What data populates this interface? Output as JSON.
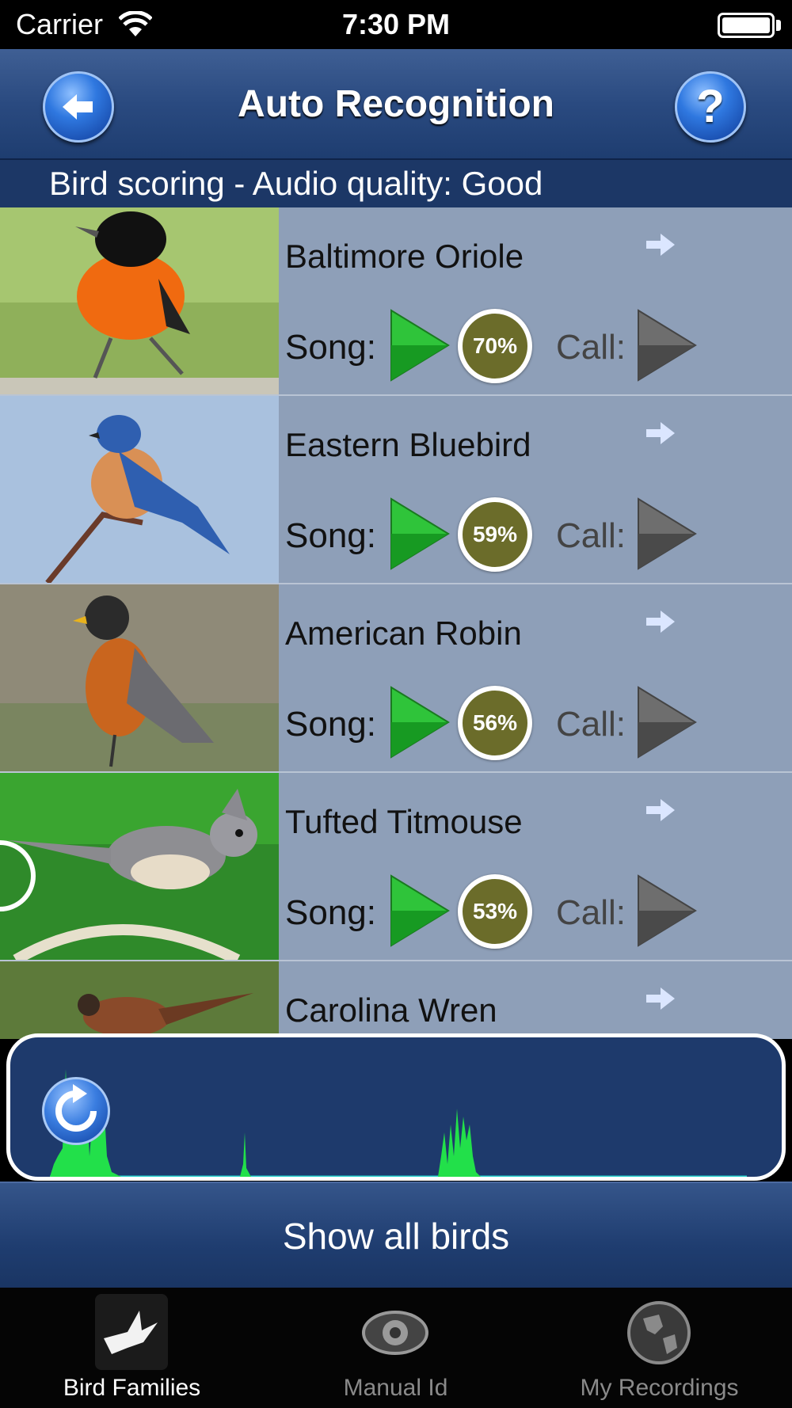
{
  "status_bar": {
    "carrier": "Carrier",
    "time": "7:30 PM"
  },
  "nav": {
    "title": "Auto Recognition",
    "help_label": "?"
  },
  "sub_header": "Bird scoring - Audio quality: Good",
  "birds": [
    {
      "name": "Baltimore Oriole",
      "song_label": "Song:",
      "score": "70%",
      "call_label": "Call:"
    },
    {
      "name": "Eastern Bluebird",
      "song_label": "Song:",
      "score": "59%",
      "call_label": "Call:"
    },
    {
      "name": "American Robin",
      "song_label": "Song:",
      "score": "56%",
      "call_label": "Call:"
    },
    {
      "name": "Tufted Titmouse",
      "song_label": "Song:",
      "score": "53%",
      "call_label": "Call:"
    },
    {
      "name": "Carolina Wren"
    }
  ],
  "show_all_label": "Show all birds",
  "tabs": [
    {
      "label": "Bird Families",
      "icon": "dove-icon",
      "active": true
    },
    {
      "label": "Manual Id",
      "icon": "eye-icon",
      "active": false
    },
    {
      "label": "My Recordings",
      "icon": "globe-icon",
      "active": false
    }
  ],
  "colors": {
    "nav": "#2a4a80",
    "list_bg": "#8e9fb8",
    "score_bg": "#6b6c2a",
    "wave": "#22e04a"
  }
}
